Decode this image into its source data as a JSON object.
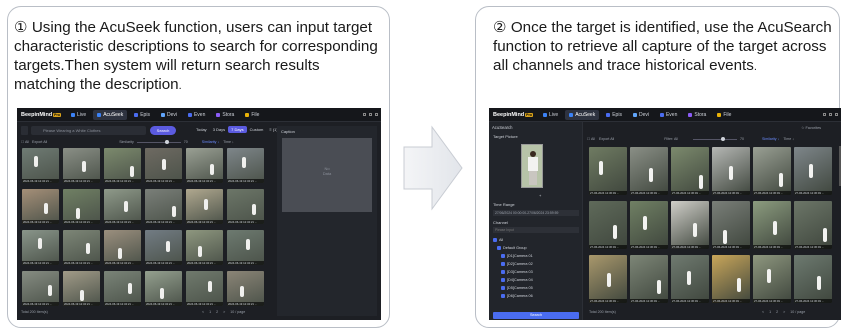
{
  "captions": {
    "step1": "① Using the AcuSeek function, users can input target characteristic descriptions to search for corresponding targets.Then system will return search results matching the description",
    "step1_end": ".",
    "step2": "② Once the target is identified, use the AcuSearch function to retrieve all capture of the target across all channels and trace historical events",
    "step2_end": "."
  },
  "app": {
    "brand": "BeepinMind",
    "pro_badge": "Pro",
    "tabs1": [
      {
        "label": "Live",
        "color": "#3b82f6"
      },
      {
        "label": "AcuSeek",
        "color": "#3b82f6",
        "active": true
      },
      {
        "label": "Epis",
        "color": "#4a6cf0"
      },
      {
        "label": "Devi",
        "color": "#60a5fa"
      },
      {
        "label": "Even",
        "color": "#4a6cf0"
      },
      {
        "label": "Stora",
        "color": "#8b5cf6"
      },
      {
        "label": "File",
        "color": "#eab308"
      }
    ],
    "tabs2": [
      {
        "label": "Live",
        "color": "#3b82f6"
      },
      {
        "label": "AcuSeek",
        "color": "#3b82f6",
        "active": true
      },
      {
        "label": "Epis",
        "color": "#4a6cf0"
      },
      {
        "label": "Devi",
        "color": "#60a5fa"
      },
      {
        "label": "Even",
        "color": "#4a6cf0"
      },
      {
        "label": "Stora",
        "color": "#8b5cf6"
      },
      {
        "label": "File",
        "color": "#eab308"
      }
    ]
  },
  "shot1": {
    "search_placeholder": "Please Wearing a White Clothes",
    "search_button": "Search",
    "filters": [
      "Today",
      "3 Days",
      "7 Days",
      "Custom",
      "≡ (1)"
    ],
    "filter_active": 2,
    "select_all": "All",
    "export_all": "Export All",
    "similarity": "Similarity",
    "similarity_value": "70",
    "sort": "Similarity ↓",
    "time": "Time ↓",
    "detail_header": "Caption",
    "detail_empty": "No Data",
    "total": "Total 200 Item(s)",
    "pager": [
      "<",
      "1",
      "2",
      ">",
      "10 / page"
    ],
    "thumb_label": "2024-06-19 12:34:21 ..."
  },
  "shot2": {
    "title": "AcuSearch",
    "favorites": "☆ Favorites",
    "target_picture": "Target Picture",
    "time_range": "Time Range",
    "time_value": "27/06/2024 00:00:00-27/06/2024 23:59:59",
    "channel": "Channel",
    "channel_filter": "Please Input",
    "tree": [
      "All",
      "Default Group",
      "[D1]Camera 01",
      "[D2]Camera 02",
      "[D3]Camera 03",
      "[D4]Camera 04",
      "[D5]Camera 05",
      "[D6]Camera 06"
    ],
    "search_button": "Search",
    "select_all": "All",
    "export_all": "Export All",
    "filter": "Filter: All",
    "similarity_value": "70",
    "sort": "Similarity ↓",
    "time": "Time ↓",
    "total": "Total 200 Item(s)",
    "pager": [
      "<",
      "1",
      "2",
      ">",
      "10 / page"
    ],
    "thumb_label": "27-06-2024 12:36:49 ..."
  }
}
